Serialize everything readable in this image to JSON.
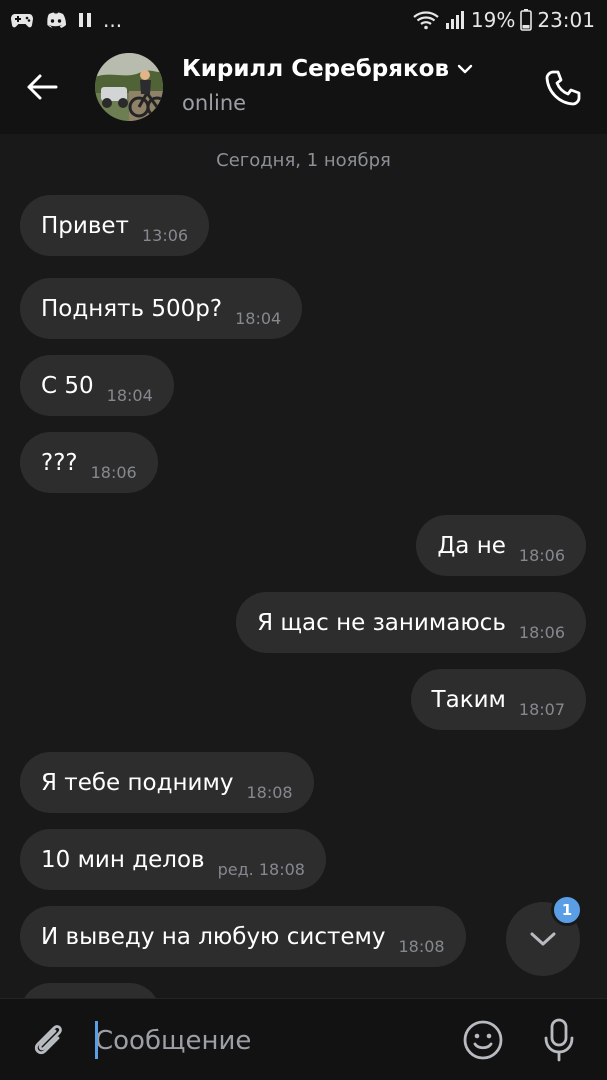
{
  "status_bar": {
    "dots": "...",
    "battery_percent": "19%",
    "time": "23:01",
    "left_icons": [
      "game-controller-icon",
      "discord-icon",
      "pause-icon"
    ],
    "right_icons": [
      "wifi-icon",
      "signal-icon",
      "battery-icon"
    ]
  },
  "header": {
    "contact_name": "Кирилл Серебряков",
    "status": "online",
    "icons": [
      "back-arrow-icon",
      "avatar",
      "chevron-down-icon",
      "phone-icon"
    ]
  },
  "chat": {
    "date_separator": "Сегодня, 1 ноября",
    "messages": [
      {
        "direction": "in",
        "text": "Привет",
        "time": "13:06"
      },
      {
        "direction": "in",
        "text": "Поднять 500р?",
        "time": "18:04"
      },
      {
        "direction": "in",
        "text": "С 50",
        "time": "18:04"
      },
      {
        "direction": "in",
        "text": "???",
        "time": "18:06"
      },
      {
        "direction": "out",
        "text": "Да не",
        "time": "18:06"
      },
      {
        "direction": "out",
        "text": "Я щас не занимаюсь",
        "time": "18:06"
      },
      {
        "direction": "out",
        "text": "Таким",
        "time": "18:07"
      },
      {
        "direction": "in",
        "text": "Я тебе подниму",
        "time": "18:08"
      },
      {
        "direction": "in",
        "text": "10 мин делов",
        "time": "ред. 18:08"
      },
      {
        "direction": "in",
        "text": "И выведу на любую систему",
        "time": "18:08"
      }
    ],
    "unread_count": "1"
  },
  "composer": {
    "placeholder": "Сообщение",
    "value": "",
    "icons": [
      "paperclip-icon",
      "emoji-icon",
      "microphone-icon"
    ]
  },
  "colors": {
    "background": "#191919",
    "bar": "#121212",
    "bubble": "#2d2d2d",
    "accent": "#5a9fe6"
  }
}
